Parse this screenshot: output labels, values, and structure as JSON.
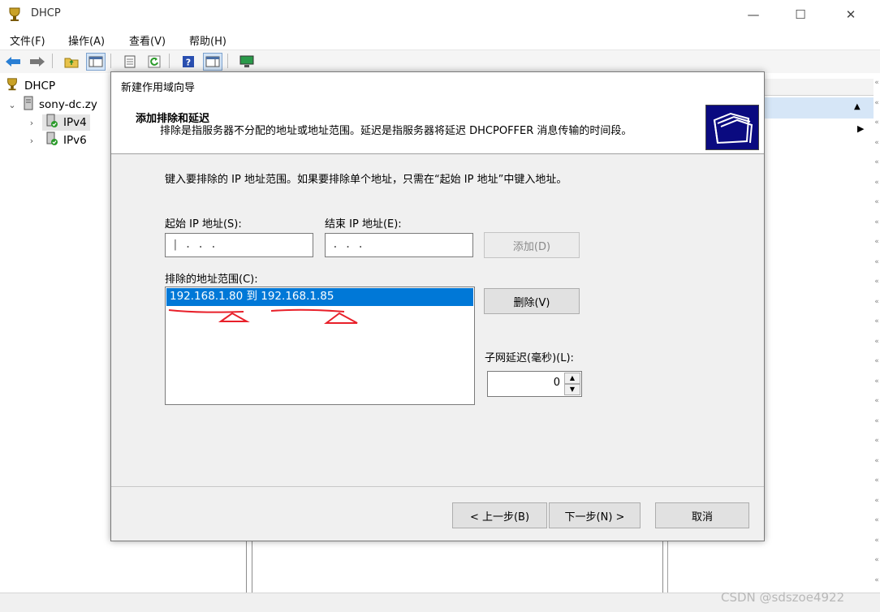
{
  "window": {
    "title": "DHCP",
    "controls": {
      "minimize": "—",
      "maximize": "☐",
      "close": "✕"
    }
  },
  "menu": [
    "文件(F)",
    "操作(A)",
    "查看(V)",
    "帮助(H)"
  ],
  "toolbar": {
    "icons": [
      "back-arrow-icon",
      "forward-arrow-icon",
      "folder-up-icon",
      "console-tree-icon",
      "properties-icon",
      "refresh-icon",
      "help-icon",
      "action-pane-icon",
      "display-icon"
    ]
  },
  "tree": {
    "root": "DHCP",
    "server": "sony-dc.zy",
    "ipv4": "IPv4",
    "ipv6": "IPv6"
  },
  "dialog": {
    "title": "新建作用域向导",
    "header_title": "添加排除和延迟",
    "header_desc": "排除是指服务器不分配的地址或地址范围。延迟是指服务器将延迟 DHCPOFFER 消息传输的时间段。",
    "instruction": "键入要排除的 IP 地址范围。如果要排除单个地址，只需在“起始 IP 地址”中键入地址。",
    "start_ip_label": "起始 IP 地址(S):",
    "end_ip_label": "结束 IP 地址(E):",
    "start_ip_value": "|  .    .    .",
    "end_ip_value": "   .    .    .",
    "add_button": "添加(D)",
    "excluded_label": "排除的地址范围(C):",
    "excluded_ranges": [
      "192.168.1.80 到 192.168.1.85"
    ],
    "remove_button": "删除(V)",
    "delay_label": "子网延迟(毫秒)(L):",
    "delay_value": "0",
    "back_button": "< 上一步(B)",
    "next_button": "下一步(N) >",
    "cancel_button": "取消"
  },
  "watermark": "CSDN @sdszoe4922",
  "colors": {
    "selection": "#0078d7",
    "annotation": "#e8202a",
    "header_icon_bg": "#0a0a80"
  }
}
